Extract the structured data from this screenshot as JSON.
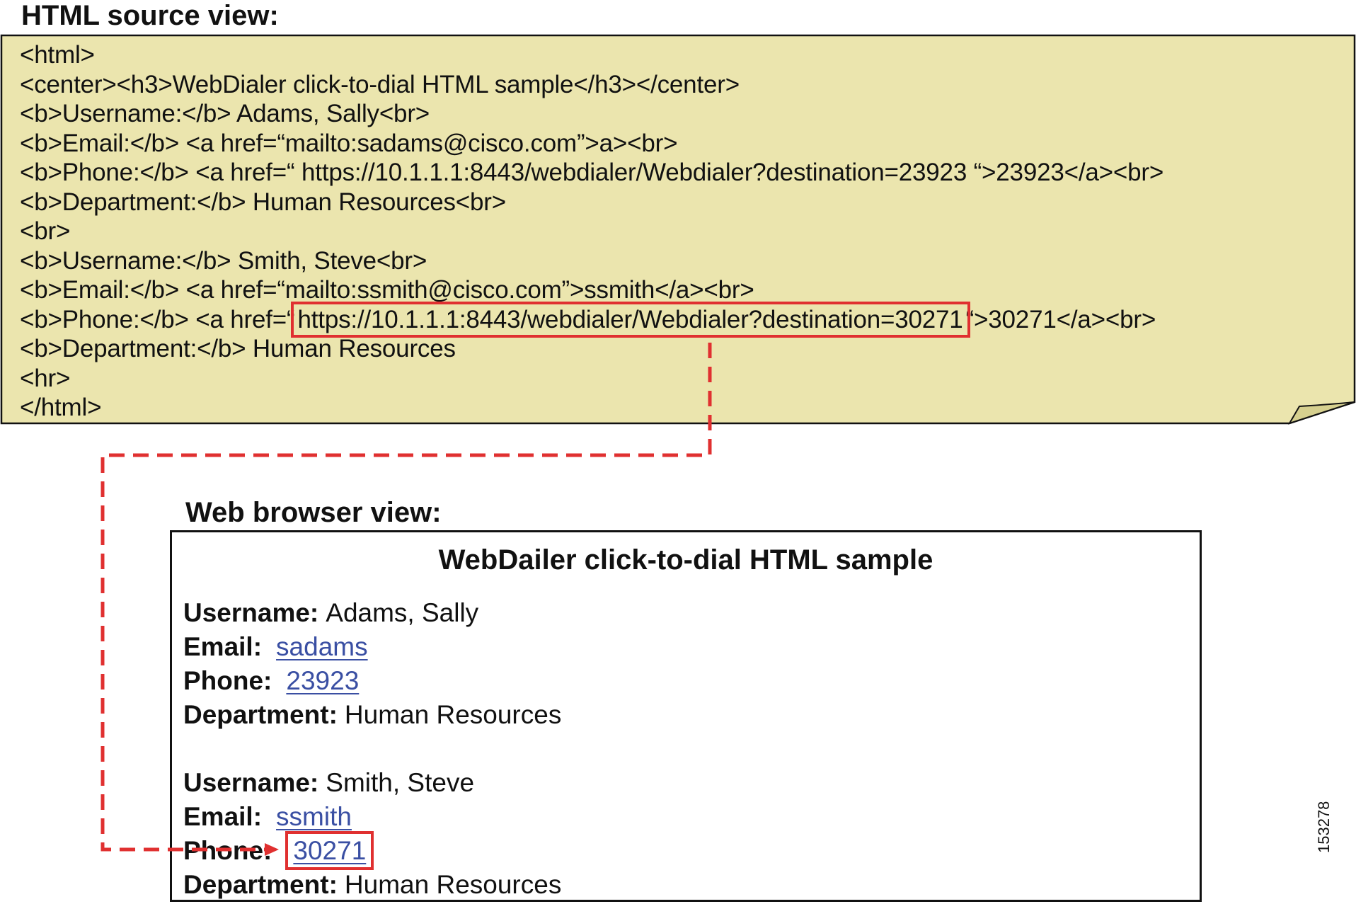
{
  "source_view": {
    "heading": "HTML source view:",
    "lines": [
      "<html>",
      "<center><h3>WebDialer click-to-dial HTML sample</h3></center>",
      "<b>Username:</b> Adams, Sally<br>",
      "<b>Email:</b> <a href=“mailto:sadams@cisco.com”>a><br>",
      "<b>Phone:</b> <a href=“ https://10.1.1.1:8443/webdialer/Webdialer?destination=23923 “>23923</a><br>",
      "<b>Department:</b> Human Resources<br>",
      "<br>",
      "<b>Username:</b> Smith, Steve<br>",
      "<b>Email:</b> <a href=“mailto:ssmith@cisco.com”>ssmith</a><br>",
      "<b>Phone:</b> <a href=“",
      "<b>Department:</b> Human Resources",
      "<hr>",
      "</html>"
    ],
    "highlighted_line": {
      "prefix": "<b>Phone:</b> <a href=“",
      "url": "https://10.1.1.1:8443/webdialer/Webdialer?destination=30271",
      "suffix": "“>30271</a><br>"
    },
    "background_color": "#ebe5ae"
  },
  "browser_view": {
    "heading": "Web browser view:",
    "title": "WebDailer click-to-dial HTML sample",
    "records": [
      {
        "username_label": "Username:",
        "username": "Adams, Sally",
        "email_label": "Email:",
        "email": "sadams",
        "phone_label": "Phone:",
        "phone": "23923",
        "department_label": "Department:",
        "department": "Human Resources"
      },
      {
        "username_label": "Username:",
        "username": "Smith, Steve",
        "email_label": "Email:",
        "email": "ssmith",
        "phone_label": "Phone:",
        "phone": "30271",
        "department_label": "Department:",
        "department": "Human Resources"
      }
    ],
    "link_color": "#3a4fa3"
  },
  "highlight_color": "#e03030",
  "figure_id": "153278"
}
